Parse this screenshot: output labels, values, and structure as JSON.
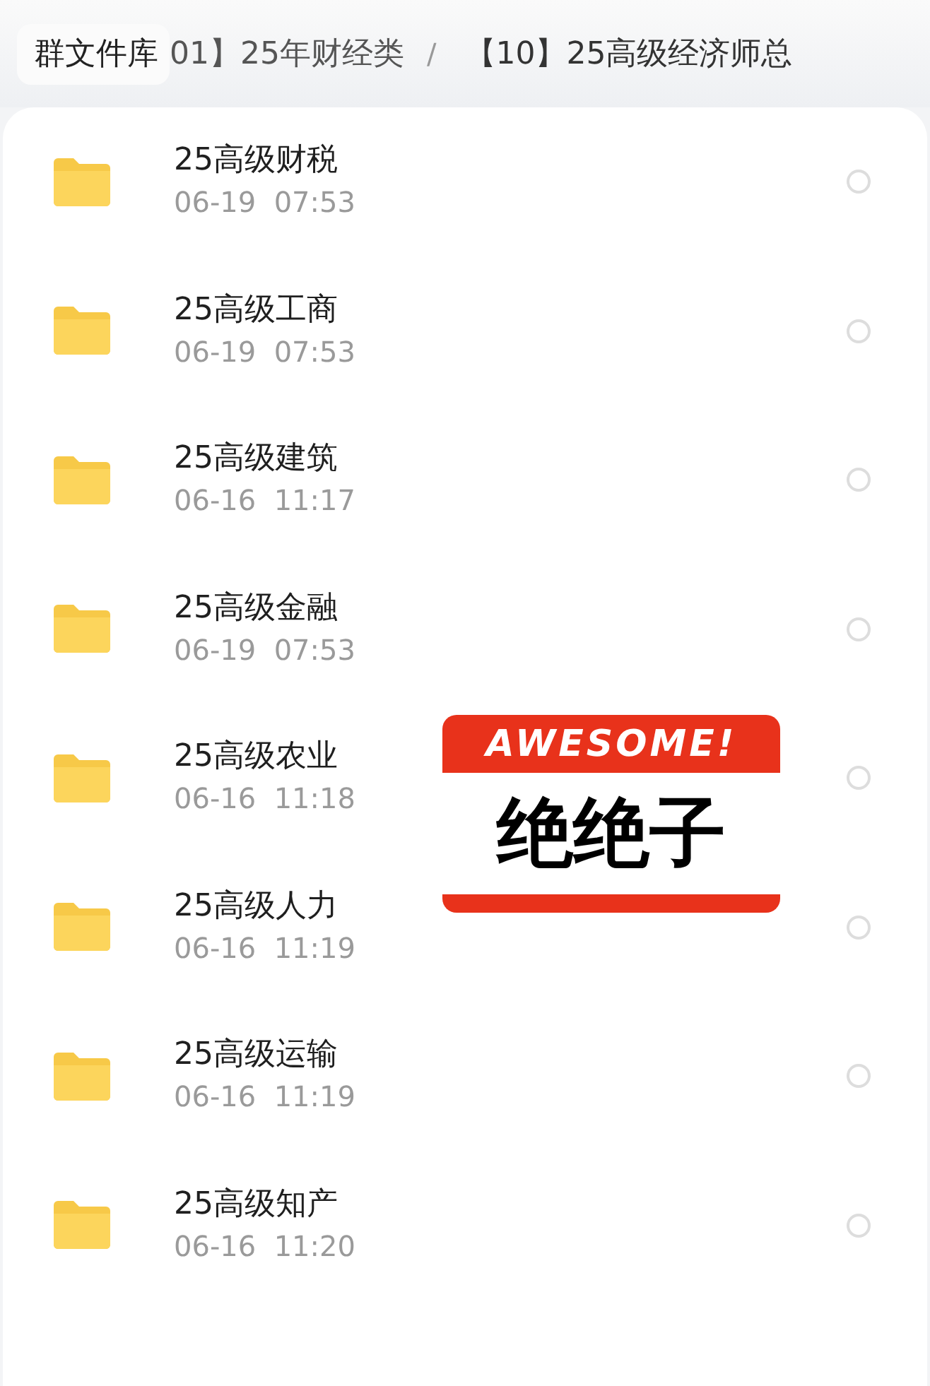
{
  "breadcrumb": {
    "root": "群文件库",
    "items": [
      {
        "label": "01】25年财经类"
      },
      {
        "label": "【10】25高级经济师总"
      }
    ],
    "separator": "/"
  },
  "files": [
    {
      "name": "25高级财税",
      "time": "06-19  07:53",
      "selected": false
    },
    {
      "name": "25高级工商",
      "time": "06-19  07:53",
      "selected": false
    },
    {
      "name": "25高级建筑",
      "time": "06-16  11:17",
      "selected": false
    },
    {
      "name": "25高级金融",
      "time": "06-19  07:53",
      "selected": false
    },
    {
      "name": "25高级农业",
      "time": "06-16  11:18",
      "selected": false
    },
    {
      "name": "25高级人力",
      "time": "06-16  11:19",
      "selected": false
    },
    {
      "name": "25高级运输",
      "time": "06-16  11:19",
      "selected": false
    },
    {
      "name": "25高级知产",
      "time": "06-16  11:20",
      "selected": false
    }
  ],
  "sticker": {
    "top_text": "AWESOME!",
    "main_text": "绝绝子"
  }
}
